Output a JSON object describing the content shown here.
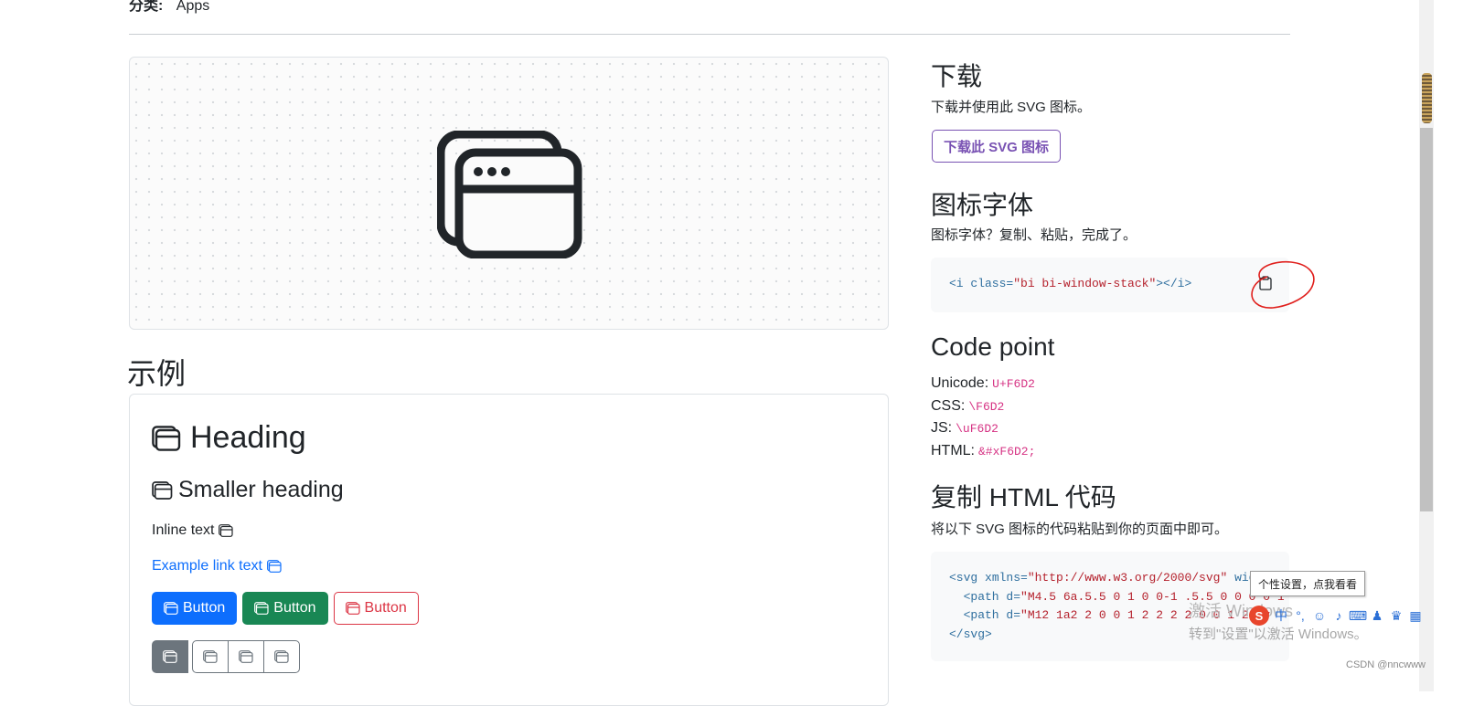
{
  "category": {
    "key": "分类:",
    "value": "Apps"
  },
  "examples_title": "示例",
  "examples": {
    "heading": "Heading",
    "smaller_heading": "Smaller heading",
    "inline_text": "Inline text",
    "link_text": "Example link text",
    "buttons": [
      "Button",
      "Button",
      "Button"
    ],
    "icon": "window-stack-icon"
  },
  "download": {
    "title": "下载",
    "description": "下载并使用此 SVG 图标。",
    "button_label": "下载此 SVG 图标"
  },
  "icon_font": {
    "title": "图标字体",
    "description": "图标字体？复制、粘贴，完成了。",
    "code_open": "<i ",
    "code_attr": "class=",
    "code_value": "\"bi bi-window-stack\"",
    "code_close": "></i>"
  },
  "code_point": {
    "title": "Code point",
    "items": [
      {
        "label": "Unicode:",
        "value": "U+F6D2"
      },
      {
        "label": "CSS:",
        "value": "\\F6D2"
      },
      {
        "label": "JS:",
        "value": "\\uF6D2"
      },
      {
        "label": "HTML:",
        "value": "&#xF6D2;"
      }
    ]
  },
  "copy_html": {
    "title": "复制 HTML 代码",
    "description": "将以下 SVG 图标的代码粘贴到你的页面中即可。",
    "line1_tag": "<svg ",
    "line1_attr": "xmlns=",
    "line1_str": "\"http://www.w3.org/2000/svg\"",
    "line1_rest": " wid",
    "line2_tag": "  <path ",
    "line2_attr": "d=",
    "line2_str": "\"M4.5 6a.5.5 0 1 0 0-1 .5.5 0 0 0 0 1",
    "line3_tag": "  <path ",
    "line3_attr": "d=",
    "line3_str": "\"M12 1a2 2 0 0 1 2 2 2 2 0 0 1 2 2v",
    "line4": "</svg>"
  },
  "overlay": {
    "tooltip": "个性设置，点我看看",
    "activate_line1": "激活 Windows",
    "activate_line2": "转到\"设置\"以激活 Windows。",
    "ime_lang": "中",
    "watermark": "CSDN @nncwww"
  },
  "colors": {
    "primary": "#0d6efd",
    "success": "#198754",
    "danger": "#dc3545",
    "brand_purple": "#7952b3",
    "code_pink": "#d63384"
  }
}
